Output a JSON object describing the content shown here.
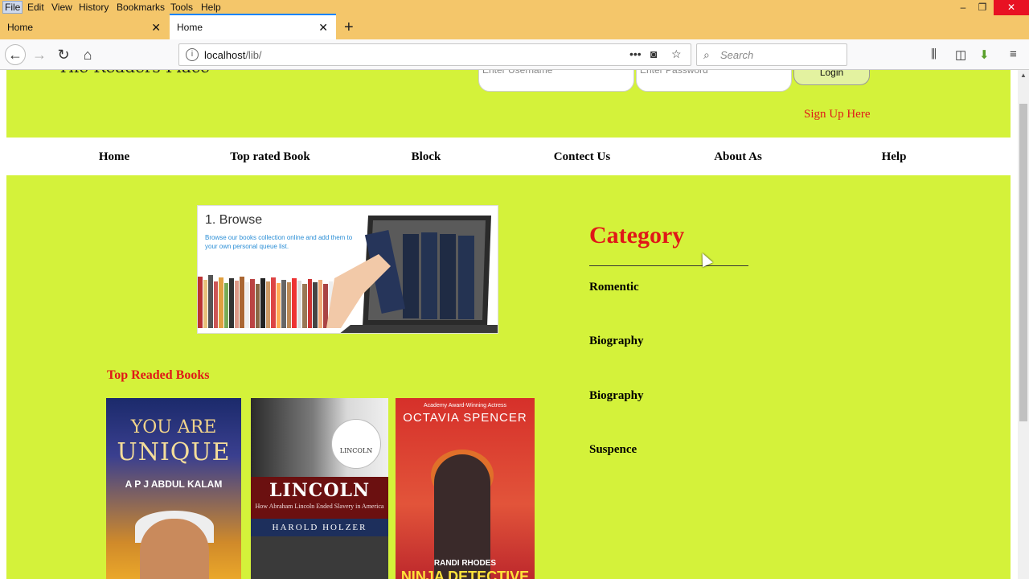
{
  "menubar": {
    "items": [
      "File",
      "Edit",
      "View",
      "History",
      "Bookmarks",
      "Tools",
      "Help"
    ]
  },
  "window_controls": {
    "minimize": "–",
    "restore": "❐",
    "close": "✕"
  },
  "tabs": [
    {
      "label": "Home",
      "active": false
    },
    {
      "label": "Home",
      "active": true
    }
  ],
  "navbar": {
    "url_host": "localhost",
    "url_path": "/lib/",
    "search_placeholder": "Search"
  },
  "header": {
    "logo": "The Readers Place",
    "username_placeholder": "Enter Username",
    "password_placeholder": "Enter Password",
    "login_label": "Login",
    "signup_link": "Sign Up Here"
  },
  "nav": {
    "items": [
      "Home",
      "Top rated Book",
      "Block",
      "Contect Us",
      "About As",
      "Help"
    ]
  },
  "browse_banner": {
    "title": "1. Browse",
    "subtitle": "Browse our books collection online and add them to your own personal queue list."
  },
  "top_books": {
    "heading": "Top Readed Books",
    "books": [
      {
        "line1": "YOU ARE",
        "line2": "UNIQUE",
        "author": "A P J ABDUL KALAM"
      },
      {
        "badge": "LINCOLN",
        "title": "LINCOLN",
        "subtitle": "How Abraham Lincoln Ended Slavery in America",
        "author": "HAROLD HOLZER"
      },
      {
        "tagline": "Academy Award-Winning Actress",
        "author": "OCTAVIA SPENCER",
        "coauthor": "RANDI RHODES",
        "title_fragment": "NINJA DETECTIVE"
      }
    ]
  },
  "category": {
    "title": "Category",
    "items": [
      "Romentic",
      "Biography",
      "Biography",
      "Suspence"
    ]
  },
  "colors": {
    "page_bg": "#d4f23a",
    "accent_red": "#e01818",
    "browser_chrome": "#f4c66a"
  }
}
